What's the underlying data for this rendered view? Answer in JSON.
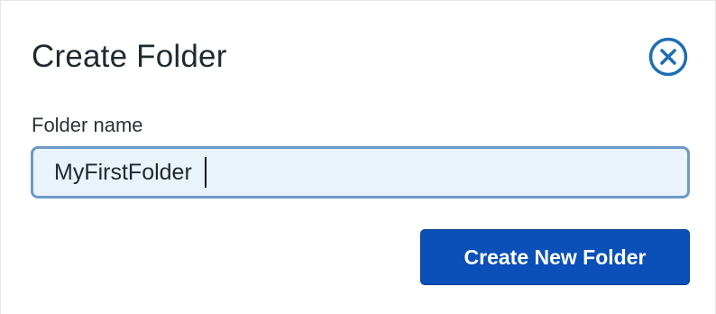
{
  "dialog": {
    "title": "Create Folder",
    "close_icon": "close-circle-icon",
    "field_label": "Folder name",
    "folder_name_value": "MyFirstFolder",
    "submit_label": "Create New Folder"
  },
  "colors": {
    "accent": "#0b50b8",
    "close_icon": "#1f6fb5",
    "input_bg": "#e9f3f9",
    "input_border": "#6d9ac8",
    "text": "#1f2a30"
  }
}
